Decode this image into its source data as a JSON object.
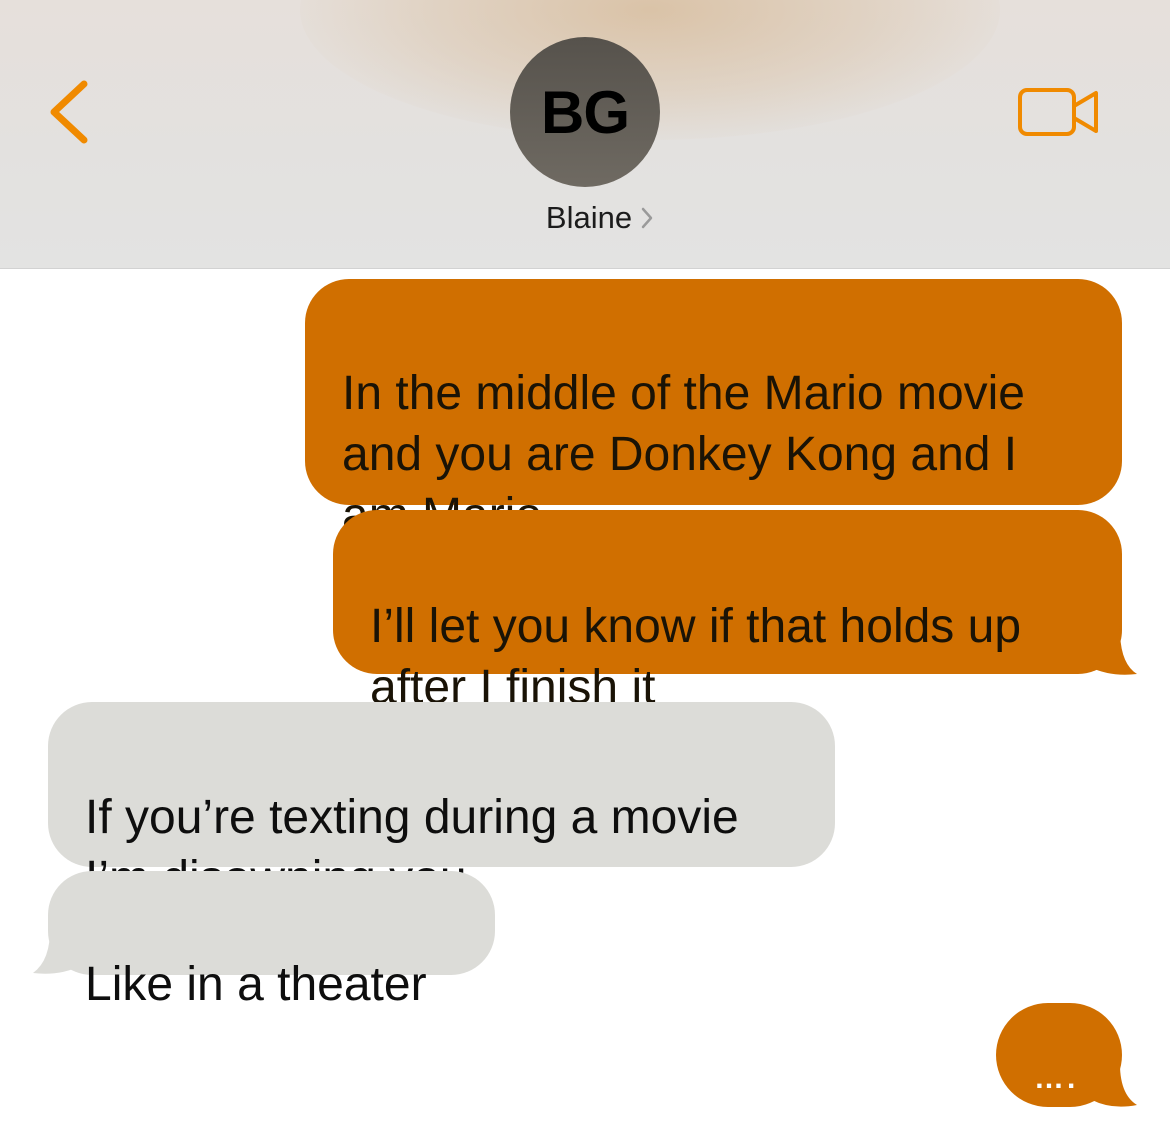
{
  "header": {
    "avatar_initials": "BG",
    "contact_name": "Blaine",
    "back_icon": "chevron-left-icon",
    "video_icon": "video-camera-icon",
    "accent_color": "#F08A00"
  },
  "messages": [
    {
      "direction": "outgoing",
      "text": "In the middle of the Mario movie\nand you are Donkey Kong and I\nam Mario"
    },
    {
      "direction": "outgoing",
      "text": "I’ll let you know if that holds up\nafter I finish it"
    },
    {
      "direction": "incoming",
      "text": "If you’re texting during a movie\nI’m disowning you"
    },
    {
      "direction": "incoming",
      "text": "Like in a theater"
    },
    {
      "direction": "outgoing",
      "text": "…."
    }
  ],
  "colors": {
    "outgoing_bubble": "#D06F00",
    "incoming_bubble": "#DCDCD8"
  }
}
